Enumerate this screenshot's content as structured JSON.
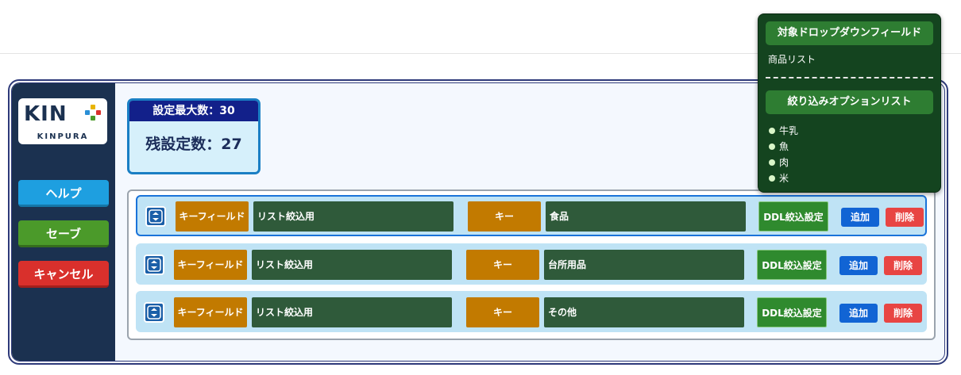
{
  "logo": {
    "top": "KIN",
    "bottom": "KINPURA"
  },
  "sidebar": {
    "help_label": "ヘルプ",
    "save_label": "セーブ",
    "cancel_label": "キャンセル"
  },
  "counter": {
    "max_label": "設定最大数：30",
    "remaining_label": "残設定数：27"
  },
  "rows": [
    {
      "key_field_label": "キーフィールド",
      "key_field_value": "リスト絞込用",
      "key_label": "キー",
      "key_value": "食品",
      "ddl_label": "DDL絞込設定",
      "add_label": "追加",
      "delete_label": "削除"
    },
    {
      "key_field_label": "キーフィールド",
      "key_field_value": "リスト絞込用",
      "key_label": "キー",
      "key_value": "台所用品",
      "ddl_label": "DDL絞込設定",
      "add_label": "追加",
      "delete_label": "削除"
    },
    {
      "key_field_label": "キーフィールド",
      "key_field_value": "リスト絞込用",
      "key_label": "キー",
      "key_value": "その他",
      "ddl_label": "DDL絞込設定",
      "add_label": "追加",
      "delete_label": "削除"
    }
  ],
  "tooltip": {
    "target_heading": "対象ドロップダウンフィールド",
    "target_value": "商品リスト",
    "options_heading": "絞り込みオプションリスト",
    "options": [
      "牛乳",
      "魚",
      "肉",
      "米"
    ]
  },
  "colors": {
    "sidebar": "#1b3150",
    "help": "#1e9fe0",
    "save": "#4b9a2a",
    "cancel": "#d9302c",
    "key_orange": "#c27a00",
    "field_green": "#2f5a3a",
    "tooltip_bg": "#14441f"
  }
}
